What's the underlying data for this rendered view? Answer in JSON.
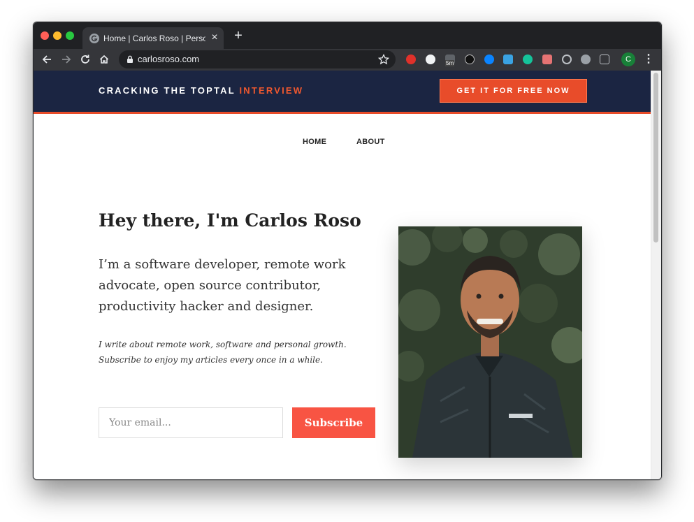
{
  "browser": {
    "tab": {
      "title": "Home | Carlos Roso | Personal"
    },
    "address_bar": {
      "url": "carlosroso.com"
    },
    "extension_badge": "5m",
    "profile_initial": "C",
    "icons": [
      "back-icon",
      "forward-icon",
      "reload-icon",
      "home-icon",
      "lock-icon",
      "star-icon",
      "close-icon",
      "plus-icon",
      "kebab-menu-icon"
    ]
  },
  "banner": {
    "text_main": "CRACKING THE TOPTAL",
    "text_accent": "INTERVIEW",
    "cta_label": "GET IT FOR FREE NOW",
    "colors": {
      "background": "#1b2542",
      "accent": "#e84c2a"
    }
  },
  "nav": {
    "items": [
      {
        "label": "HOME"
      },
      {
        "label": "ABOUT"
      }
    ]
  },
  "hero": {
    "headline": "Hey there, I'm Carlos Roso",
    "intro": "I’m a software developer, remote work advocate, open source contributor, productivity hacker and designer.",
    "blurb": "I write about remote work, software and personal growth. Subscribe to enjoy my articles every once in a while.",
    "email_placeholder": "Your email...",
    "subscribe_label": "Subscribe",
    "colors": {
      "subscribe": "#f85443"
    }
  }
}
